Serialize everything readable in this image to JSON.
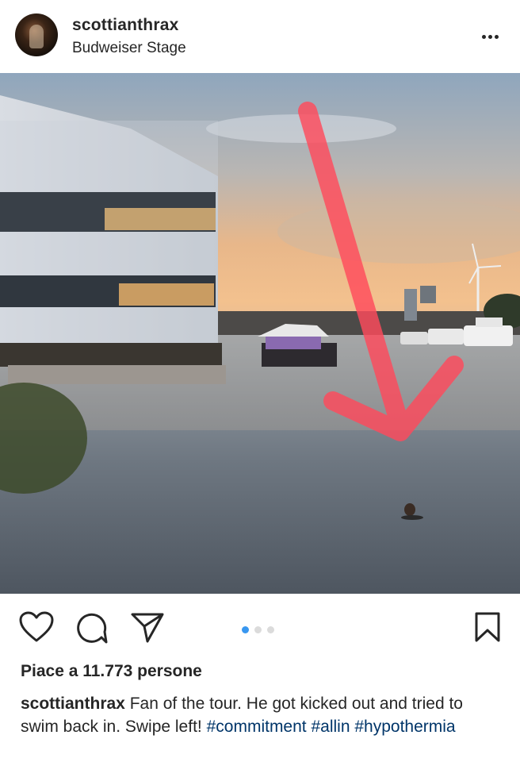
{
  "post": {
    "username": "scottianthrax",
    "location": "Budweiser Stage",
    "likes_text": "Piace a 11.773 persone",
    "caption": {
      "username": "scottianthrax",
      "text": " Fan of the tour. He got kicked out and tried to swim back in. Swipe left! ",
      "hashtags": [
        "#commitment",
        "#allin",
        "#hypothermia"
      ]
    },
    "carousel": {
      "total": 3,
      "current": 1
    }
  },
  "icons": {
    "more": "more-options-icon",
    "like": "heart-icon",
    "comment": "comment-icon",
    "share": "share-icon",
    "save": "bookmark-icon"
  },
  "colors": {
    "text": "#262626",
    "hashtag": "#003569",
    "carousel_active": "#3897f0",
    "carousel_inactive": "#dbdbdb",
    "arrow": "#ff4a5c"
  }
}
